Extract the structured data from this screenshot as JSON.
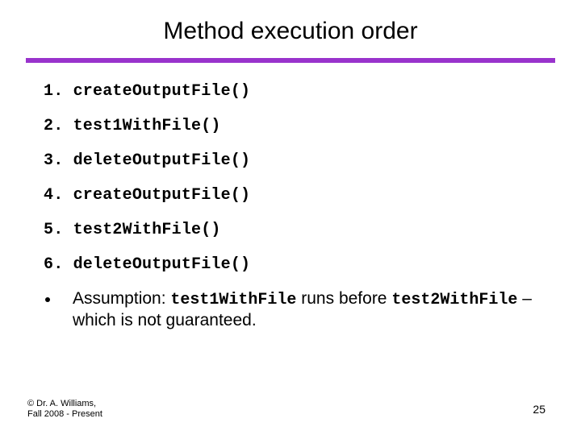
{
  "title": "Method execution order",
  "items": [
    "1. createOutputFile()",
    "2. test1WithFile()",
    "3. deleteOutputFile()",
    "4. createOutputFile()",
    "5. test2WithFile()",
    "6. deleteOutputFile()"
  ],
  "bullet": {
    "lead": "Assumption: ",
    "code1": "test1WithFile",
    "mid": " runs before ",
    "code2": "test2WithFile",
    "tail": " – which is not guaranteed."
  },
  "footer": {
    "author": "© Dr. A. Williams,",
    "term": "Fall 2008 - Present",
    "page": "25"
  },
  "colors": {
    "accent": "#9933cc"
  }
}
